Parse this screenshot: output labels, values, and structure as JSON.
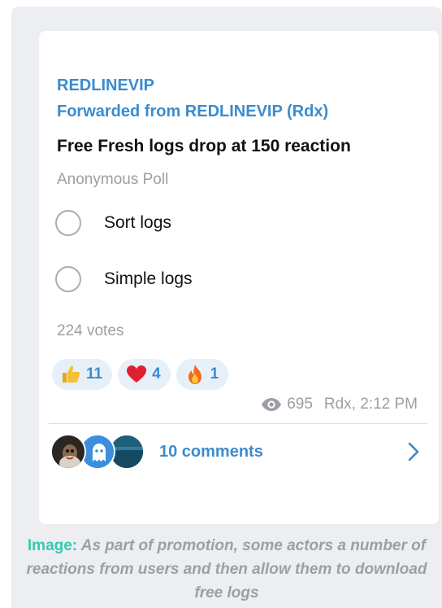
{
  "message": {
    "channel_name": "REDLINEVIP",
    "forwarded_from": "Forwarded from REDLINEVIP (Rdx)",
    "question": "Free Fresh logs drop at 150 reaction",
    "poll_type": "Anonymous Poll",
    "options": [
      {
        "label": "Sort logs"
      },
      {
        "label": "Simple logs"
      }
    ],
    "votes": "224 votes",
    "reactions": [
      {
        "emoji": "thumbs-up",
        "count": "11"
      },
      {
        "emoji": "red-heart",
        "count": "4"
      },
      {
        "emoji": "fire",
        "count": "1"
      }
    ],
    "views": "695",
    "author_time": "Rdx, 2:12 PM",
    "comments": "10 comments"
  },
  "caption": {
    "label": "Image:",
    "text": "As part of promotion, some actors a number of reactions from users and then allow them to download free logs"
  },
  "colors": {
    "accent": "#3a8ccf",
    "caption_label": "#35c9b0",
    "muted": "#9aa0a6",
    "panel_bg": "#eceef2",
    "reaction_bg": "#e6f0f9"
  }
}
